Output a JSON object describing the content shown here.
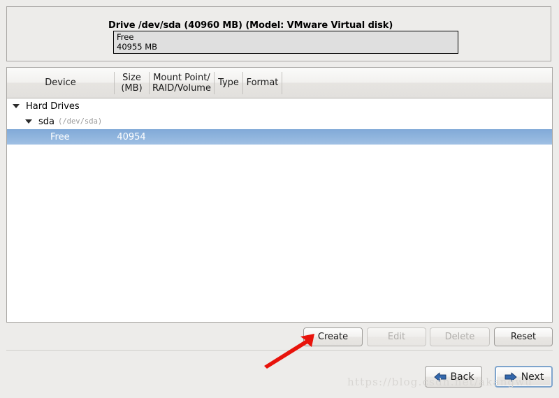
{
  "drive_panel": {
    "title": "Drive /dev/sda (40960 MB) (Model: VMware Virtual disk)",
    "segments": [
      {
        "label": "Free",
        "size": "40955 MB"
      }
    ]
  },
  "tree": {
    "columns": [
      {
        "key": "device",
        "label": "Device"
      },
      {
        "key": "size",
        "label": "Size\n(MB)",
        "line1": "Size",
        "line2": "(MB)"
      },
      {
        "key": "mount",
        "label": "Mount Point/\nRAID/Volume",
        "line1": "Mount Point/",
        "line2": "RAID/Volume"
      },
      {
        "key": "type",
        "label": "Type"
      },
      {
        "key": "format",
        "label": "Format"
      }
    ],
    "rows": [
      {
        "depth": 0,
        "twisty": "expanded",
        "device": "Hard Drives",
        "path": "",
        "size": "",
        "mount": "",
        "type": "",
        "format": "",
        "selected": false
      },
      {
        "depth": 1,
        "twisty": "expanded",
        "device": "sda",
        "path": "(/dev/sda)",
        "size": "",
        "mount": "",
        "type": "",
        "format": "",
        "selected": false
      },
      {
        "depth": 2,
        "twisty": "none",
        "device": "Free",
        "path": "",
        "size": "40954",
        "mount": "",
        "type": "",
        "format": "",
        "selected": true
      }
    ]
  },
  "actions": [
    {
      "label": "Create",
      "enabled": true
    },
    {
      "label": "Edit",
      "enabled": false
    },
    {
      "label": "Delete",
      "enabled": false
    },
    {
      "label": "Reset",
      "enabled": true
    }
  ],
  "nav": {
    "back": {
      "label": "Back",
      "icon": "arrow-left-icon"
    },
    "next": {
      "label": "Next",
      "icon": "arrow-right-icon",
      "focused": true
    }
  },
  "annotation": {
    "arrow": {
      "color": "#e8130b",
      "points_to": "Create"
    }
  },
  "watermark": {
    "text": "https://blog.csdn.net/akangwu"
  },
  "colors": {
    "window_bg": "#edecea",
    "panel_border": "#a8a6a3",
    "tree_bg": "#ffffff",
    "selection_blue": "#8fb4dd",
    "selection_text": "#ffffff",
    "disabled_text": "#b0aeab",
    "nav_arrow_blue": "#2a5fa5",
    "annotation_red": "#e8130b",
    "watermark_gray": "#d8d6d3"
  }
}
